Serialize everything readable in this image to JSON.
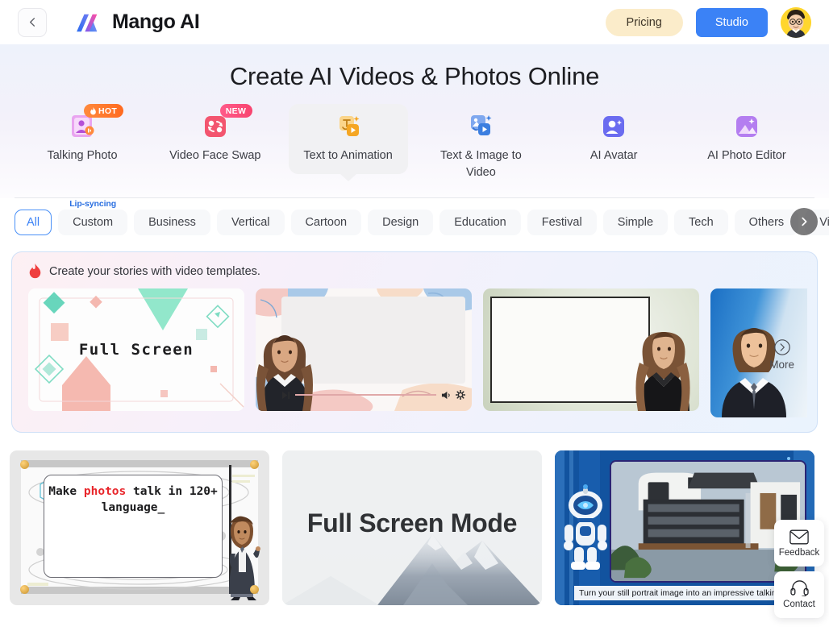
{
  "header": {
    "back_icon": "chevron-left-icon",
    "brand_name": "Mango AI",
    "pricing_label": "Pricing",
    "studio_label": "Studio",
    "avatar_name": "user-avatar"
  },
  "hero": {
    "title": "Create AI Videos & Photos Online"
  },
  "features": [
    {
      "label": "Talking Photo",
      "badge": "HOT",
      "badge_type": "hot",
      "icon": "talking-photo-icon",
      "active": false
    },
    {
      "label": "Video Face Swap",
      "badge": "NEW",
      "badge_type": "new",
      "icon": "face-swap-icon",
      "active": false
    },
    {
      "label": "Text to Animation",
      "badge": "",
      "badge_type": "",
      "icon": "text-animation-icon",
      "active": true
    },
    {
      "label": "Text & Image to Video",
      "badge": "",
      "badge_type": "",
      "icon": "text-image-video-icon",
      "active": false
    },
    {
      "label": "AI Avatar",
      "badge": "",
      "badge_type": "",
      "icon": "ai-avatar-icon",
      "active": false
    },
    {
      "label": "AI Photo Editor",
      "badge": "",
      "badge_type": "",
      "icon": "ai-photo-editor-icon",
      "active": false
    }
  ],
  "chips": [
    {
      "label": "All",
      "badge": "",
      "active": true
    },
    {
      "label": "Custom",
      "badge": "Lip-syncing",
      "active": false
    },
    {
      "label": "Business",
      "badge": "",
      "active": false
    },
    {
      "label": "Vertical",
      "badge": "",
      "active": false
    },
    {
      "label": "Cartoon",
      "badge": "",
      "active": false
    },
    {
      "label": "Design",
      "badge": "",
      "active": false
    },
    {
      "label": "Education",
      "badge": "",
      "active": false
    },
    {
      "label": "Festival",
      "badge": "",
      "active": false
    },
    {
      "label": "Simple",
      "badge": "",
      "active": false
    },
    {
      "label": "Tech",
      "badge": "",
      "active": false
    },
    {
      "label": "Others",
      "badge": "",
      "active": false
    },
    {
      "label": "Virtual P",
      "badge": "",
      "active": false
    }
  ],
  "scroll_right_icon": "chevron-right-icon",
  "templates_panel": {
    "heading": "Create your stories with video templates.",
    "heading_icon": "fire-icon",
    "more_label": "More",
    "more_icon": "circle-arrow-right-icon",
    "cards": [
      {
        "name": "full-screen-template",
        "title": "Full Screen"
      },
      {
        "name": "presenter-player-template",
        "title": ""
      },
      {
        "name": "whiteboard-presenter-template",
        "title": ""
      },
      {
        "name": "business-man-template",
        "title": ""
      }
    ]
  },
  "gallery": [
    {
      "name": "make-photos-talk-card",
      "text_before": "Make ",
      "text_highlight": "photos",
      "text_after": " talk in 120+ language_"
    },
    {
      "name": "full-screen-mode-card",
      "title": "Full Screen Mode"
    },
    {
      "name": "talking-portrait-card",
      "caption": "Turn your still portrait image into an impressive talking p"
    }
  ],
  "float_widget": [
    {
      "label": "Feedback",
      "icon": "envelope-icon"
    },
    {
      "label": "Contact",
      "icon": "headset-icon"
    }
  ],
  "colors": {
    "accent_blue": "#3b82f6",
    "pricing_bg": "#fbecca",
    "chip_active_border": "#4a90f7",
    "badge_hot": "#ff6a1f",
    "badge_new": "#f8446f",
    "highlight_red": "#e8262b"
  }
}
